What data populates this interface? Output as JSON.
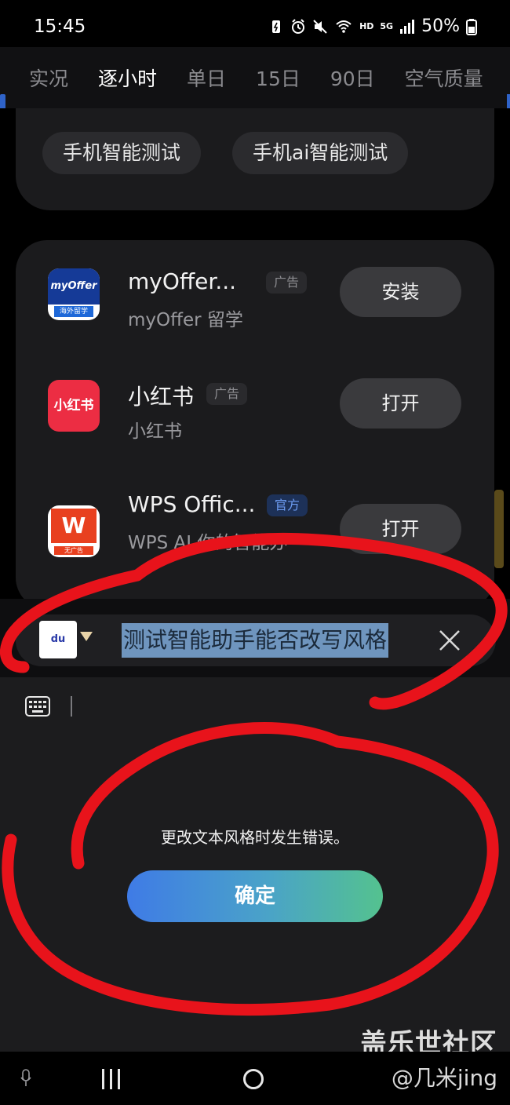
{
  "status_bar": {
    "time": "15:45",
    "network": "5G",
    "hd": "HD",
    "battery": "50%",
    "icons": [
      "battery-saver-icon",
      "alarm-icon",
      "mute-icon",
      "wifi-icon",
      "signal-icon",
      "battery-icon"
    ]
  },
  "tabs": [
    {
      "label": "实况",
      "active": false
    },
    {
      "label": "逐小时",
      "active": true
    },
    {
      "label": "单日",
      "active": false
    },
    {
      "label": "15日",
      "active": false
    },
    {
      "label": "90日",
      "active": false
    },
    {
      "label": "空气质量",
      "active": false
    }
  ],
  "suggestions": {
    "chips": [
      "手机智能测试",
      "手机ai智能测试"
    ]
  },
  "apps": [
    {
      "name": "myOffer...",
      "subtitle": "myOffer 留学",
      "tag": "广告",
      "button": "安装",
      "icon_text": "myOffer",
      "icon_sub": "海外留学"
    },
    {
      "name": "小红书",
      "subtitle": "小红书",
      "tag": "广告",
      "button": "打开",
      "icon_text": "小红书"
    },
    {
      "name": "WPS Offic...",
      "subtitle": "WPS AI 你的智能办",
      "tag": "官方",
      "button": "打开",
      "icon_text": "W",
      "icon_sub": "无广告"
    }
  ],
  "search": {
    "engine_logo": "du",
    "query": "测试智能助手能否改写风格"
  },
  "dialog": {
    "message": "更改文本风格时发生错误。",
    "confirm_label": "确定"
  },
  "watermark": {
    "line1": "盖乐世社区",
    "line2": "@几米jing"
  },
  "colors": {
    "accent_blue": "#3f7be6",
    "accent_green": "#54c28f",
    "annotation_red": "#e8131b",
    "selection": "#6f95be"
  }
}
